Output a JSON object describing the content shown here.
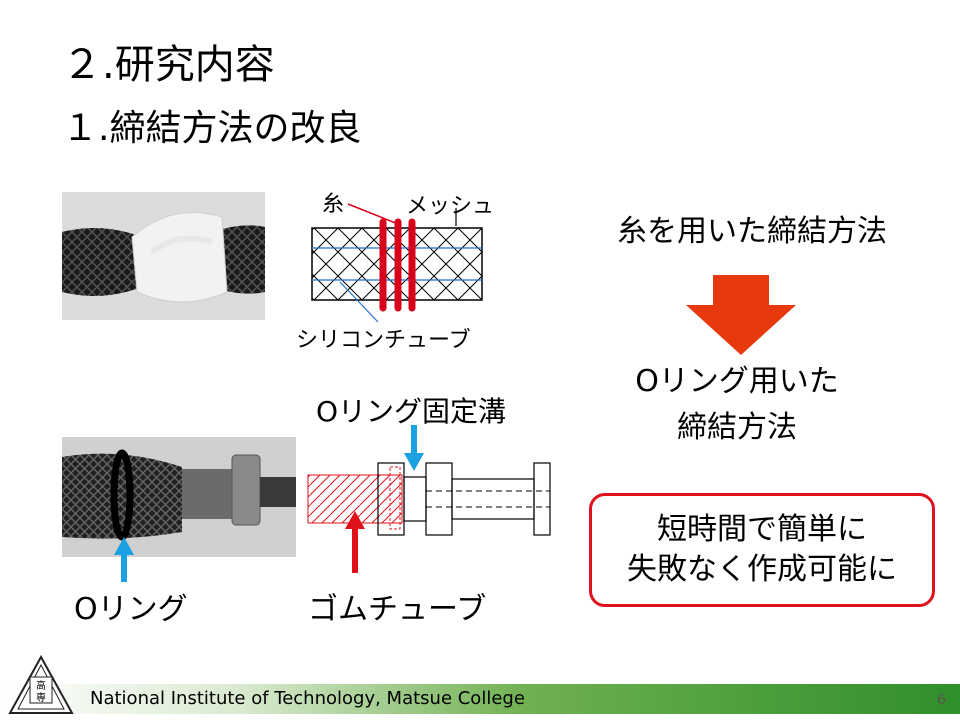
{
  "slide": {
    "title": "２.研究内容",
    "subtitle": "１.締結方法の改良",
    "page_number": "6"
  },
  "diagram1": {
    "label_thread": "糸",
    "label_mesh": "メッシュ",
    "label_tube": "シリコンチューブ"
  },
  "diagram2": {
    "label_groove": "Oリング固定溝",
    "label_rubber": "ゴムチューブ",
    "label_oring": "Oリング"
  },
  "right": {
    "method_old": "糸を用いた締結方法",
    "method_new_line1": "Oリング用いた",
    "method_new_line2": "締結方法",
    "benefit_line1": "短時間で簡単に",
    "benefit_line2": "失敗なく作成可能に"
  },
  "footer": {
    "institution": "National Institute of Technology, Matsue College",
    "logo_text": "高専"
  },
  "colors": {
    "arrow_red": "#e8380d",
    "box_red": "#e0111b",
    "blue": "#1ba1e2",
    "green": "#2f8f2a"
  }
}
